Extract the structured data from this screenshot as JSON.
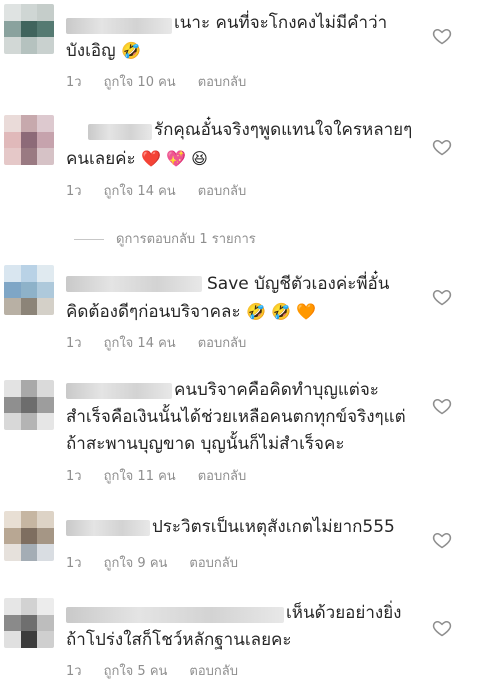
{
  "comments": [
    {
      "line1": "เนาะ คนที่จะโกงคงไม่มีคำว่า",
      "line2": "บังเอิญ",
      "emojis": "🤣",
      "time": "1ว",
      "likes": "ถูกใจ 10 คน",
      "reply": "ตอบกลับ",
      "avatar_colors": [
        "#dfe3e2",
        "#cfd6d4",
        "#c5cdca",
        "#8aa29e",
        "#40645d",
        "#557a72",
        "#d2d8d6",
        "#b5c2bf",
        "#c9d1cf"
      ]
    },
    {
      "line1": "รักคุณอั๋นจริงๆพูดแทนใจใครหลายๆ",
      "line2": "คนเลยค่ะ",
      "emojis": "❤️ 💖 😆",
      "time": "1ว",
      "likes": "ถูกใจ 14 คน",
      "reply": "ตอบกลับ",
      "avatar_colors": [
        "#eadbd9",
        "#c7a9ad",
        "#ddc9cf",
        "#e0b9ba",
        "#8d6a78",
        "#c6a3ad",
        "#e5c8c8",
        "#9a7a82",
        "#d6c2c6"
      ]
    },
    {
      "line1": "Save บัญชีตัวเองค่ะพี่อั๋น",
      "line2": "คิดต้องดีๆก่อนบริจาคละ",
      "emojis": "🤣 🤣 🧡",
      "time": "1ว",
      "likes": "ถูกใจ 14 คน",
      "reply": "ตอบกลับ",
      "avatar_colors": [
        "#d9e6f0",
        "#b9d2e6",
        "#e0eaf0",
        "#7fa6c6",
        "#8eb2c9",
        "#aec9db",
        "#b8b0a4",
        "#8c8478",
        "#d4d0c8"
      ]
    },
    {
      "line1": "คนบริจาคคือคิดทำบุญแต่จะ",
      "line2": "สำเร็จคือเงินนั้นได้ช่วยเหลือคนตกทุกข์จริงๆแต่",
      "line3": "ถ้าสะพานบุญขาด บุญนั้นก็ไม่สำเร็จคะ",
      "time": "1ว",
      "likes": "ถูกใจ 11 คน",
      "reply": "ตอบกลับ",
      "avatar_colors": [
        "#e3e3e3",
        "#a9a9a9",
        "#dadada",
        "#8f8f8f",
        "#6d6d6d",
        "#9d9d9d",
        "#d8d8d8",
        "#b4b4b4",
        "#e6e6e6"
      ]
    },
    {
      "line1": "ประวิตรเป็นเหตุสังเกตไม่ยาก555",
      "time": "1ว",
      "likes": "ถูกใจ 9 คน",
      "reply": "ตอบกลับ",
      "avatar_colors": [
        "#e8dfd4",
        "#c6b6a2",
        "#ddd3c6",
        "#b8a793",
        "#7e6e60",
        "#a59685",
        "#e6e1dc",
        "#a4adb5",
        "#d9dde2"
      ]
    },
    {
      "line1": "เห็นด้วยอย่างยิ่ง",
      "line2": "ถ้าโปร่งใสก็โชว์หลักฐานเลยคะ",
      "time": "1ว",
      "likes": "ถูกใจ 5 คน",
      "reply": "ตอบกลับ",
      "avatar_colors": [
        "#e6e6e6",
        "#d2d2d2",
        "#ececec",
        "#8a8a8a",
        "#6f6f6f",
        "#bdbdbd",
        "#e0e0e0",
        "#3c3c3c",
        "#cfcfcf"
      ]
    }
  ],
  "view_replies": "ดูการตอบกลับ 1 รายการ",
  "icons": {
    "like": "heart-outline-icon",
    "avatar": "blurred-avatar"
  }
}
